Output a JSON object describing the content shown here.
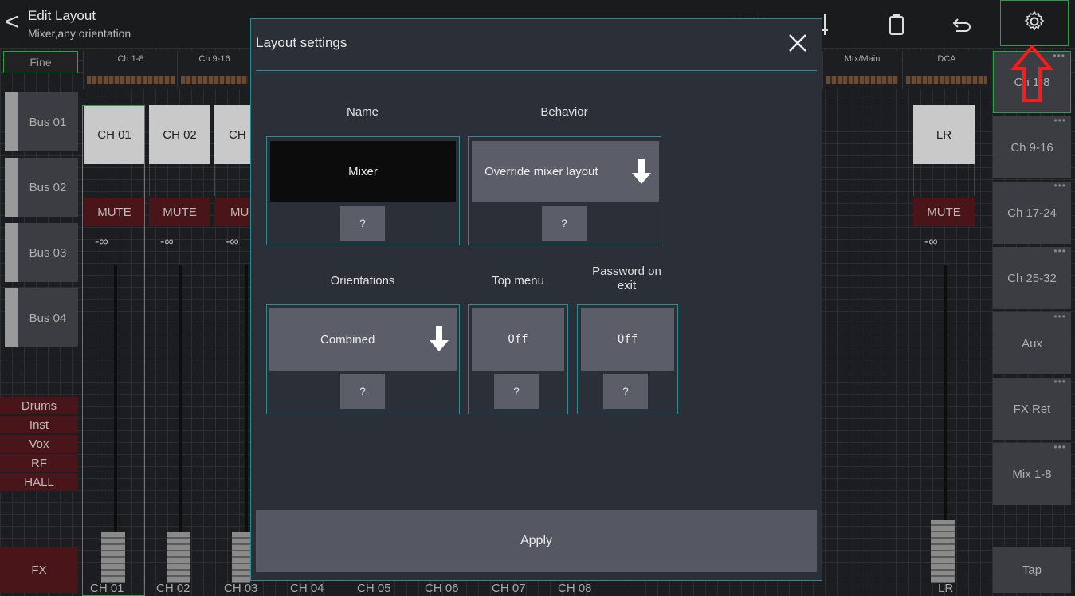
{
  "header": {
    "title": "Edit Layout",
    "subtitle": "Mixer,any orientation"
  },
  "mixer": {
    "fine_label": "Fine",
    "meter_groups": [
      "Ch 1-8",
      "Ch 9-16",
      "Mtx/Main",
      "DCA"
    ],
    "buses": [
      "Bus 01",
      "Bus 02",
      "Bus 03",
      "Bus 04"
    ],
    "tags": [
      "Drums",
      "Inst",
      "Vox",
      "RF",
      "HALL"
    ],
    "fx_label": "FX",
    "channels": [
      "CH 01",
      "CH 02",
      "CH"
    ],
    "mute_label": "MUTE",
    "mute_short": "MU",
    "inf_label": "-∞",
    "bottom_labels": [
      "CH 01",
      "CH 02",
      "CH 03",
      "CH 04",
      "CH 05",
      "CH 06",
      "CH 07",
      "CH 08"
    ],
    "main_channel": "LR",
    "main_bottom": "LR"
  },
  "side_panel": {
    "items": [
      "Ch 1-8",
      "Ch 9-16",
      "Ch 17-24",
      "Ch 25-32",
      "Aux",
      "FX Ret",
      "Mix 1-8"
    ],
    "tap_label": "Tap",
    "dots": "•••"
  },
  "dialog": {
    "title": "Layout settings",
    "name_label": "Name",
    "name_value": "Mixer",
    "behavior_label": "Behavior",
    "behavior_value": "Override mixer layout",
    "orientations_label": "Orientations",
    "orientations_value": "Combined",
    "top_menu_label": "Top menu",
    "top_menu_value": "Off",
    "password_label_1": "Password on",
    "password_label_2": "exit",
    "password_value": "Off",
    "help": "?",
    "apply_label": "Apply"
  },
  "colors": {
    "accent_green": "#29a346",
    "dialog_border": "#2c8c94",
    "mute_red": "#4a1518",
    "highlight_red": "#ff1a1a"
  }
}
